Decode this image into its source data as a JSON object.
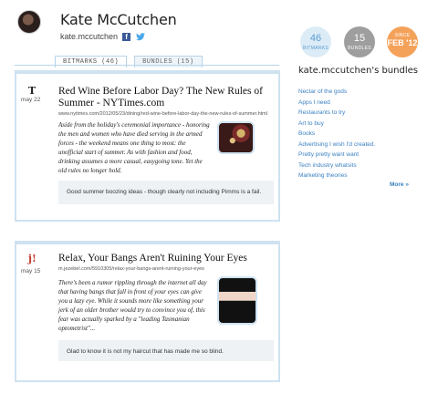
{
  "profile": {
    "name": "Kate McCutchen",
    "handle": "kate.mccutchen"
  },
  "stats": {
    "bitmarks_count": "46",
    "bitmarks_label": "BITMARKS",
    "bundles_count": "15",
    "bundles_label": "BUNDLES",
    "since_label": "SINCE",
    "since_value": "FEB '12"
  },
  "tabs": [
    {
      "label": "BITMARKS (46)",
      "active": true
    },
    {
      "label": "BUNDLES (15)",
      "active": false
    }
  ],
  "bitmarks": [
    {
      "source_icon": "T",
      "date": "may 22",
      "title": "Red Wine Before Labor Day? The New Rules of Summer - NYTimes.com",
      "url": "www.nytimes.com/2012/05/23/dining/red-wine-before-labor-day-the-new-rules-of-summer.html",
      "excerpt": "Aside from the holiday's ceremonial importance - honoring the men and women who have died serving in the armed forces - the weekend means one thing to most: the unofficial start of summer. As with fashion and food, drinking assumes a more casual, easygoing tone. Yet the old rules no longer hold.",
      "comment": "Good summer boozing ideas - though clearly not including Pimms is a fail."
    },
    {
      "source_icon": "j!",
      "date": "may 15",
      "title": "Relax, Your Bangs Aren't Ruining Your Eyes",
      "url": "m.jezebel.com/5910305/relax-your-bangs-arent-ruining-your-eyes",
      "excerpt": "There's been a rumor rippling through the internet all day that having bangs that fall in front of your eyes can give you a lazy eye. While it sounds more like something your jerk of an older brother would try to convince you of, this fear was actually sparked by a \"leading Tasmanian optometrist\"...",
      "comment": "Glad to know it is not my haircut that has made me so blind."
    }
  ],
  "sidebar": {
    "title": "kate.mccutchen's bundles",
    "bundles": [
      "Nectar of the gods",
      "Apps I need",
      "Restaurants to try",
      "Art to buy",
      "Books",
      "Advertising I wish I'd created.",
      "Pretty pretty want want",
      "Tech industry whatsits",
      "Marketing theories"
    ],
    "more_label": "More »"
  }
}
